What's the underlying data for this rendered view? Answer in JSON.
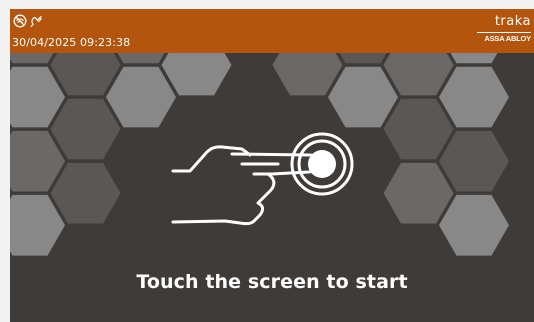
{
  "header": {
    "status_icons": [
      "no-signal-icon",
      "unplugged-icon"
    ],
    "datetime": "30/04/2025 09:23:38",
    "logo_text": "traka",
    "logo_subtext": "ASSA ABLOY"
  },
  "main": {
    "prompt": "Touch the screen to start",
    "icon": "hand-touch-icon"
  },
  "colors": {
    "header_bg": "#b4550d",
    "screen_bg": "#3f3b38",
    "hex_light": "#888888",
    "hex_mid": "#6b6967",
    "hex_dark": "#5a5755"
  }
}
